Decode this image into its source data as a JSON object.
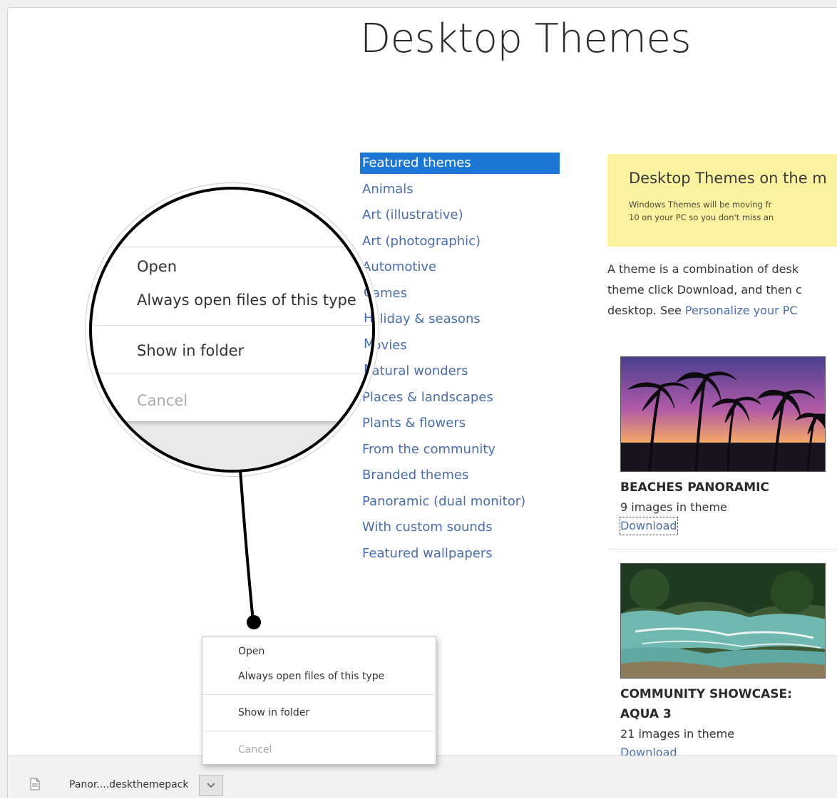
{
  "page": {
    "title": "Desktop Themes"
  },
  "nav": {
    "items": [
      "Featured themes",
      "Animals",
      "Art (illustrative)",
      "Art (photographic)",
      "Automotive",
      "Games",
      "Holiday & seasons",
      "Movies",
      "Natural wonders",
      "Places & landscapes",
      "Plants & flowers",
      "From the community",
      "Branded themes",
      "Panoramic (dual monitor)",
      "With custom sounds",
      "Featured wallpapers"
    ],
    "selected": "Featured themes"
  },
  "notice": {
    "title": "Desktop Themes on the m",
    "line1": "Windows Themes will be moving fr",
    "line2": "10 on your PC so you don't miss an"
  },
  "description": {
    "line1": "A theme is a combination of desk",
    "line2": "theme click Download, and then c",
    "line3_prefix": "desktop. See ",
    "line3_link": "Personalize your PC"
  },
  "themes": [
    {
      "name": "BEACHES PANORAMIC",
      "count": "9 images in theme",
      "download": "Download"
    },
    {
      "name": "COMMUNITY SHOWCASE: AQUA 3",
      "count": "21 images in theme",
      "download": "Download"
    }
  ],
  "context_menu": {
    "open": "Open",
    "always_open": "Always open files of this type",
    "show_in_folder": "Show in folder",
    "cancel": "Cancel"
  },
  "magnified_menu": {
    "open": "Open",
    "always_open": "Always open files of this type",
    "show_in_folder": "Show in folder",
    "cancel": "Cancel"
  },
  "download_bar": {
    "filename": "Panor....deskthemepack",
    "icons": {
      "file": "file-icon",
      "arrow": "chevron-down-icon"
    }
  },
  "colors": {
    "link": "#4a6dad",
    "nav_selected_bg": "#1c76d4",
    "notice_bg": "#fbf29f"
  }
}
